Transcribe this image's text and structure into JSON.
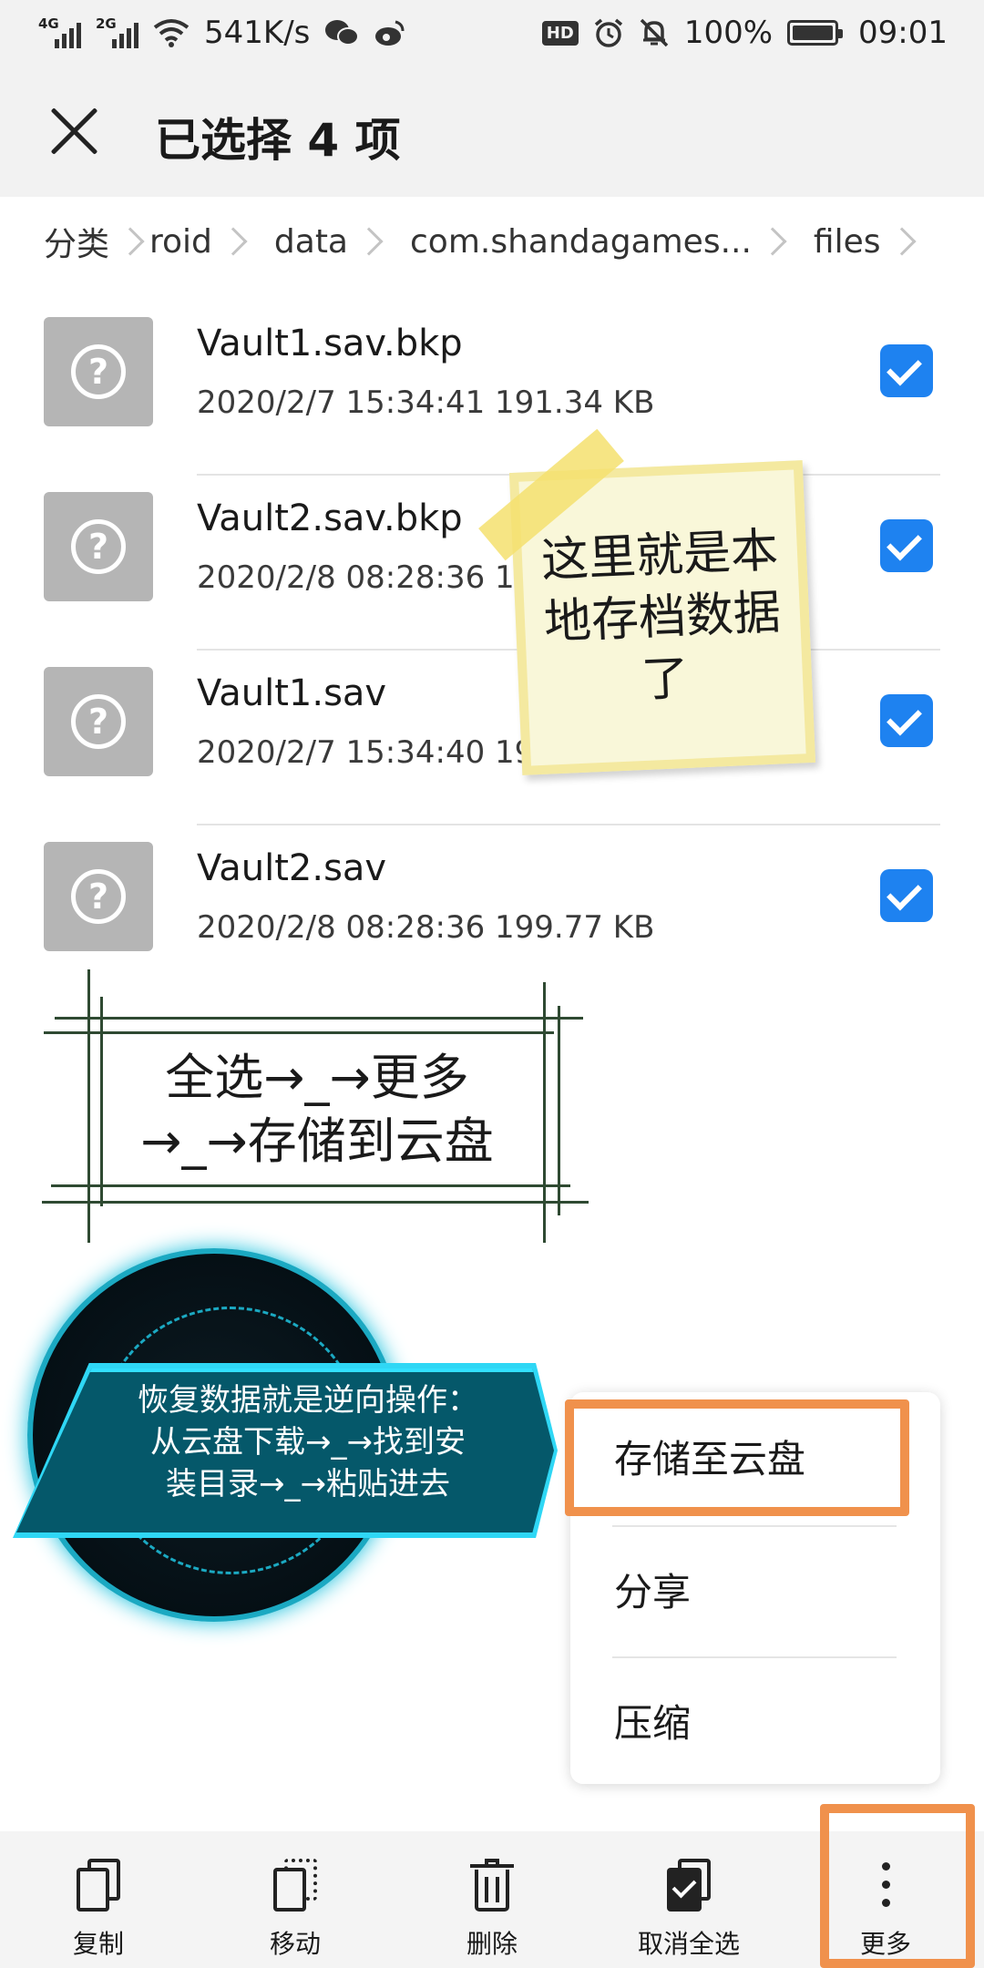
{
  "status_bar": {
    "net_gen_1": "4G",
    "net_gen_2": "2G",
    "net_speed": "541K/s",
    "hd_badge": "HD",
    "battery": "100%",
    "time": "09:01"
  },
  "header": {
    "title": "已选择 4 项"
  },
  "breadcrumb": [
    "分类",
    "roid",
    "data",
    "com.shandagames...",
    "files"
  ],
  "files": [
    {
      "name": "Vault1.sav.bkp",
      "meta": "2020/2/7 15:34:41 191.34 KB",
      "checked": true
    },
    {
      "name": "Vault2.sav.bkp",
      "meta": "2020/2/8 08:28:36 199.77 KB",
      "checked": true
    },
    {
      "name": "Vault1.sav",
      "meta": "2020/2/7 15:34:40 191.34 KB",
      "checked": true
    },
    {
      "name": "Vault2.sav",
      "meta": "2020/2/8 08:28:36 199.77 KB",
      "checked": true
    }
  ],
  "file_icon_glyph": "?",
  "annotations": {
    "sticky_note": "这里就是本地存档数据了",
    "frame_line_1": "全选→_→更多",
    "frame_line_2": "→_→存储到云盘",
    "ribbon_line_1": "恢复数据就是逆向操作：",
    "ribbon_line_2": "从云盘下载→_→找到安",
    "ribbon_line_3": "装目录→_→粘贴进去"
  },
  "menu": {
    "items": [
      "存储至云盘",
      "分享",
      "压缩"
    ]
  },
  "toolbar": {
    "items": [
      "复制",
      "移动",
      "删除",
      "取消全选",
      "更多"
    ]
  },
  "colors": {
    "accent": "#1e82f0",
    "highlight": "#f0914c",
    "sticky": "#f9f7d9",
    "ribbon": "#05586a"
  }
}
